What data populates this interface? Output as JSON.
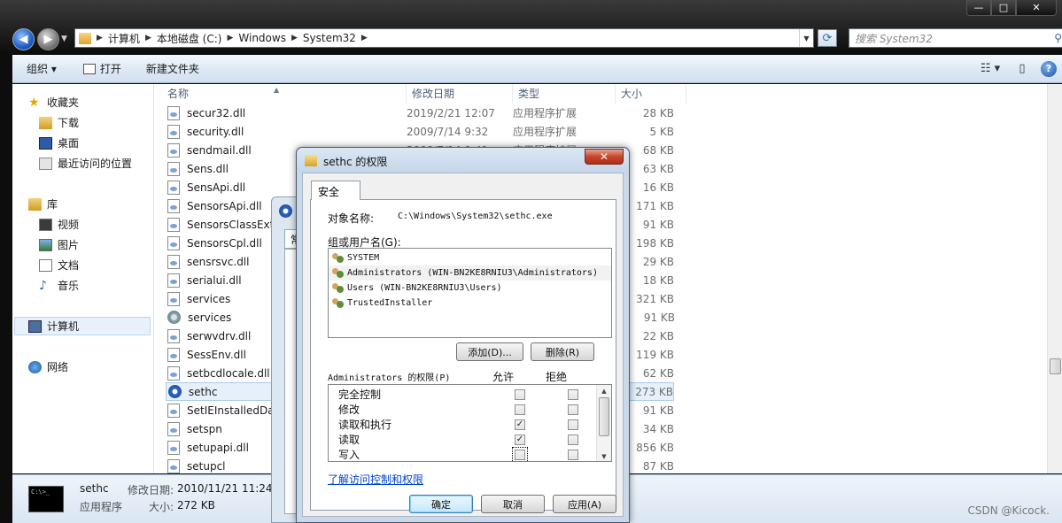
{
  "window": {
    "controls": [
      "—",
      "□",
      "✕"
    ]
  },
  "navigation": {
    "breadcrumbs": [
      "计算机",
      "本地磁盘 (C:)",
      "Windows",
      "System32"
    ],
    "search_placeholder": "搜索 System32"
  },
  "toolbar": {
    "organize": "组织 ▾",
    "open": "打开",
    "new_folder": "新建文件夹"
  },
  "sidebar": {
    "favorites": "收藏夹",
    "downloads": "下载",
    "desktop": "桌面",
    "recent": "最近访问的位置",
    "libraries": "库",
    "videos": "视频",
    "pictures": "图片",
    "documents": "文档",
    "music": "音乐",
    "computer": "计算机",
    "network": "网络"
  },
  "columns": {
    "name": "名称",
    "date": "修改日期",
    "type": "类型",
    "size": "大小"
  },
  "files": [
    {
      "name": "secur32.dll",
      "date": "2019/2/21 12:07",
      "type": "应用程序扩展",
      "size": "28 KB"
    },
    {
      "name": "security.dll",
      "date": "2009/7/14 9:32",
      "type": "应用程序扩展",
      "size": "5 KB"
    },
    {
      "name": "sendmail.dll",
      "date": "2009/7/14 9:41",
      "type": "应用程序扩展",
      "size": "68 KB"
    },
    {
      "name": "Sens.dll",
      "date": "",
      "type": "",
      "size": "63 KB"
    },
    {
      "name": "SensApi.dll",
      "date": "",
      "type": "",
      "size": "16 KB"
    },
    {
      "name": "SensorsApi.dll",
      "date": "",
      "type": "",
      "size": "171 KB"
    },
    {
      "name": "SensorsClassExte",
      "date": "",
      "type": "",
      "size": "91 KB"
    },
    {
      "name": "SensorsCpl.dll",
      "date": "",
      "type": "",
      "size": "198 KB"
    },
    {
      "name": "sensrsvc.dll",
      "date": "",
      "type": "",
      "size": "29 KB"
    },
    {
      "name": "serialui.dll",
      "date": "",
      "type": "",
      "size": "18 KB"
    },
    {
      "name": "services",
      "date": "",
      "type": "",
      "size": "321 KB"
    },
    {
      "name": "services",
      "date": "",
      "type": "",
      "size": "91 KB"
    },
    {
      "name": "serwvdrv.dll",
      "date": "",
      "type": "",
      "size": "22 KB"
    },
    {
      "name": "SessEnv.dll",
      "date": "",
      "type": "",
      "size": "119 KB"
    },
    {
      "name": "setbcdlocale.dll",
      "date": "",
      "type": "",
      "size": "62 KB"
    },
    {
      "name": "sethc",
      "date": "",
      "type": "",
      "size": "273 KB"
    },
    {
      "name": "SetIEInstalledDat",
      "date": "",
      "type": "",
      "size": "91 KB"
    },
    {
      "name": "setspn",
      "date": "",
      "type": "",
      "size": "34 KB"
    },
    {
      "name": "setupapi.dll",
      "date": "",
      "type": "",
      "size": "856 KB"
    },
    {
      "name": "setupcl",
      "date": "",
      "type": "",
      "size": "87 KB"
    }
  ],
  "details": {
    "name": "sethc",
    "type": "应用程序",
    "modified_label": "修改日期:",
    "modified_value": "2010/11/21 11:24",
    "size_label": "大小:",
    "size_value": "272 KB",
    "thumb_text": "C:\\>_"
  },
  "properties_back": {
    "tab_char": "常"
  },
  "dialog": {
    "title": "sethc 的权限",
    "close": "✕",
    "tab": "安全",
    "object_label": "对象名称:",
    "object_value": "C:\\Windows\\System32\\sethc.exe",
    "groups_label": "组或用户名(G):",
    "users": [
      "SYSTEM",
      "Administrators (WIN-BN2KE8RNIU3\\Administrators)",
      "Users (WIN-BN2KE8RNIU3\\Users)",
      "TrustedInstaller"
    ],
    "add_button": "添加(D)...",
    "remove_button": "删除(R)",
    "perm_label": "Administrators 的权限(P)",
    "allow_header": "允许",
    "deny_header": "拒绝",
    "permissions": [
      {
        "name": "完全控制",
        "allow": "",
        "deny": ""
      },
      {
        "name": "修改",
        "allow": "",
        "deny": ""
      },
      {
        "name": "读取和执行",
        "allow": "✓",
        "deny": ""
      },
      {
        "name": "读取",
        "allow": "✓",
        "deny": ""
      },
      {
        "name": "写入",
        "allow": "",
        "deny": ""
      }
    ],
    "link": "了解访问控制和权限",
    "ok": "确定",
    "cancel": "取消",
    "apply": "应用(A)"
  },
  "watermark": "CSDN @Kicock."
}
